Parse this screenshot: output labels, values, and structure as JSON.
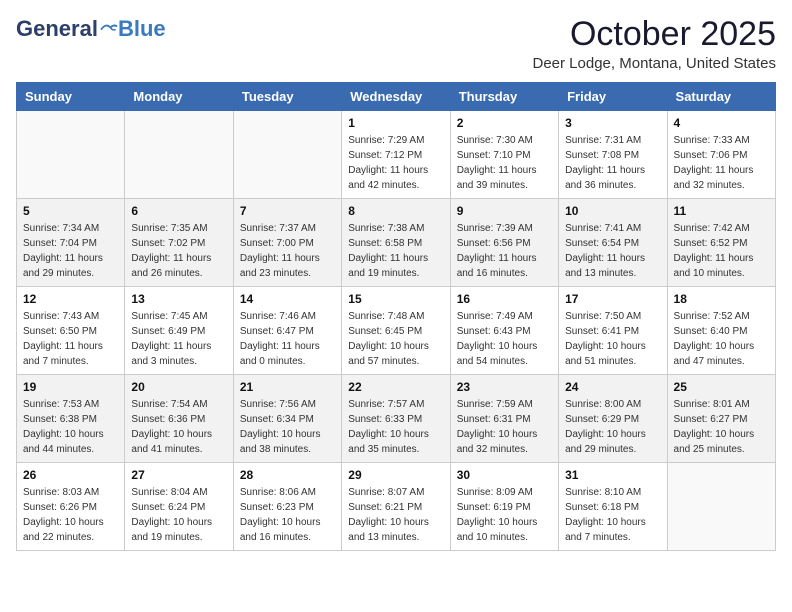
{
  "header": {
    "logo": {
      "general": "General",
      "blue": "Blue"
    },
    "title": "October 2025",
    "location": "Deer Lodge, Montana, United States"
  },
  "weekdays": [
    "Sunday",
    "Monday",
    "Tuesday",
    "Wednesday",
    "Thursday",
    "Friday",
    "Saturday"
  ],
  "weeks": [
    [
      {
        "day": "",
        "sunrise": "",
        "sunset": "",
        "daylight": ""
      },
      {
        "day": "",
        "sunrise": "",
        "sunset": "",
        "daylight": ""
      },
      {
        "day": "",
        "sunrise": "",
        "sunset": "",
        "daylight": ""
      },
      {
        "day": "1",
        "sunrise": "Sunrise: 7:29 AM",
        "sunset": "Sunset: 7:12 PM",
        "daylight": "Daylight: 11 hours and 42 minutes."
      },
      {
        "day": "2",
        "sunrise": "Sunrise: 7:30 AM",
        "sunset": "Sunset: 7:10 PM",
        "daylight": "Daylight: 11 hours and 39 minutes."
      },
      {
        "day": "3",
        "sunrise": "Sunrise: 7:31 AM",
        "sunset": "Sunset: 7:08 PM",
        "daylight": "Daylight: 11 hours and 36 minutes."
      },
      {
        "day": "4",
        "sunrise": "Sunrise: 7:33 AM",
        "sunset": "Sunset: 7:06 PM",
        "daylight": "Daylight: 11 hours and 32 minutes."
      }
    ],
    [
      {
        "day": "5",
        "sunrise": "Sunrise: 7:34 AM",
        "sunset": "Sunset: 7:04 PM",
        "daylight": "Daylight: 11 hours and 29 minutes."
      },
      {
        "day": "6",
        "sunrise": "Sunrise: 7:35 AM",
        "sunset": "Sunset: 7:02 PM",
        "daylight": "Daylight: 11 hours and 26 minutes."
      },
      {
        "day": "7",
        "sunrise": "Sunrise: 7:37 AM",
        "sunset": "Sunset: 7:00 PM",
        "daylight": "Daylight: 11 hours and 23 minutes."
      },
      {
        "day": "8",
        "sunrise": "Sunrise: 7:38 AM",
        "sunset": "Sunset: 6:58 PM",
        "daylight": "Daylight: 11 hours and 19 minutes."
      },
      {
        "day": "9",
        "sunrise": "Sunrise: 7:39 AM",
        "sunset": "Sunset: 6:56 PM",
        "daylight": "Daylight: 11 hours and 16 minutes."
      },
      {
        "day": "10",
        "sunrise": "Sunrise: 7:41 AM",
        "sunset": "Sunset: 6:54 PM",
        "daylight": "Daylight: 11 hours and 13 minutes."
      },
      {
        "day": "11",
        "sunrise": "Sunrise: 7:42 AM",
        "sunset": "Sunset: 6:52 PM",
        "daylight": "Daylight: 11 hours and 10 minutes."
      }
    ],
    [
      {
        "day": "12",
        "sunrise": "Sunrise: 7:43 AM",
        "sunset": "Sunset: 6:50 PM",
        "daylight": "Daylight: 11 hours and 7 minutes."
      },
      {
        "day": "13",
        "sunrise": "Sunrise: 7:45 AM",
        "sunset": "Sunset: 6:49 PM",
        "daylight": "Daylight: 11 hours and 3 minutes."
      },
      {
        "day": "14",
        "sunrise": "Sunrise: 7:46 AM",
        "sunset": "Sunset: 6:47 PM",
        "daylight": "Daylight: 11 hours and 0 minutes."
      },
      {
        "day": "15",
        "sunrise": "Sunrise: 7:48 AM",
        "sunset": "Sunset: 6:45 PM",
        "daylight": "Daylight: 10 hours and 57 minutes."
      },
      {
        "day": "16",
        "sunrise": "Sunrise: 7:49 AM",
        "sunset": "Sunset: 6:43 PM",
        "daylight": "Daylight: 10 hours and 54 minutes."
      },
      {
        "day": "17",
        "sunrise": "Sunrise: 7:50 AM",
        "sunset": "Sunset: 6:41 PM",
        "daylight": "Daylight: 10 hours and 51 minutes."
      },
      {
        "day": "18",
        "sunrise": "Sunrise: 7:52 AM",
        "sunset": "Sunset: 6:40 PM",
        "daylight": "Daylight: 10 hours and 47 minutes."
      }
    ],
    [
      {
        "day": "19",
        "sunrise": "Sunrise: 7:53 AM",
        "sunset": "Sunset: 6:38 PM",
        "daylight": "Daylight: 10 hours and 44 minutes."
      },
      {
        "day": "20",
        "sunrise": "Sunrise: 7:54 AM",
        "sunset": "Sunset: 6:36 PM",
        "daylight": "Daylight: 10 hours and 41 minutes."
      },
      {
        "day": "21",
        "sunrise": "Sunrise: 7:56 AM",
        "sunset": "Sunset: 6:34 PM",
        "daylight": "Daylight: 10 hours and 38 minutes."
      },
      {
        "day": "22",
        "sunrise": "Sunrise: 7:57 AM",
        "sunset": "Sunset: 6:33 PM",
        "daylight": "Daylight: 10 hours and 35 minutes."
      },
      {
        "day": "23",
        "sunrise": "Sunrise: 7:59 AM",
        "sunset": "Sunset: 6:31 PM",
        "daylight": "Daylight: 10 hours and 32 minutes."
      },
      {
        "day": "24",
        "sunrise": "Sunrise: 8:00 AM",
        "sunset": "Sunset: 6:29 PM",
        "daylight": "Daylight: 10 hours and 29 minutes."
      },
      {
        "day": "25",
        "sunrise": "Sunrise: 8:01 AM",
        "sunset": "Sunset: 6:27 PM",
        "daylight": "Daylight: 10 hours and 25 minutes."
      }
    ],
    [
      {
        "day": "26",
        "sunrise": "Sunrise: 8:03 AM",
        "sunset": "Sunset: 6:26 PM",
        "daylight": "Daylight: 10 hours and 22 minutes."
      },
      {
        "day": "27",
        "sunrise": "Sunrise: 8:04 AM",
        "sunset": "Sunset: 6:24 PM",
        "daylight": "Daylight: 10 hours and 19 minutes."
      },
      {
        "day": "28",
        "sunrise": "Sunrise: 8:06 AM",
        "sunset": "Sunset: 6:23 PM",
        "daylight": "Daylight: 10 hours and 16 minutes."
      },
      {
        "day": "29",
        "sunrise": "Sunrise: 8:07 AM",
        "sunset": "Sunset: 6:21 PM",
        "daylight": "Daylight: 10 hours and 13 minutes."
      },
      {
        "day": "30",
        "sunrise": "Sunrise: 8:09 AM",
        "sunset": "Sunset: 6:19 PM",
        "daylight": "Daylight: 10 hours and 10 minutes."
      },
      {
        "day": "31",
        "sunrise": "Sunrise: 8:10 AM",
        "sunset": "Sunset: 6:18 PM",
        "daylight": "Daylight: 10 hours and 7 minutes."
      },
      {
        "day": "",
        "sunrise": "",
        "sunset": "",
        "daylight": ""
      }
    ]
  ]
}
